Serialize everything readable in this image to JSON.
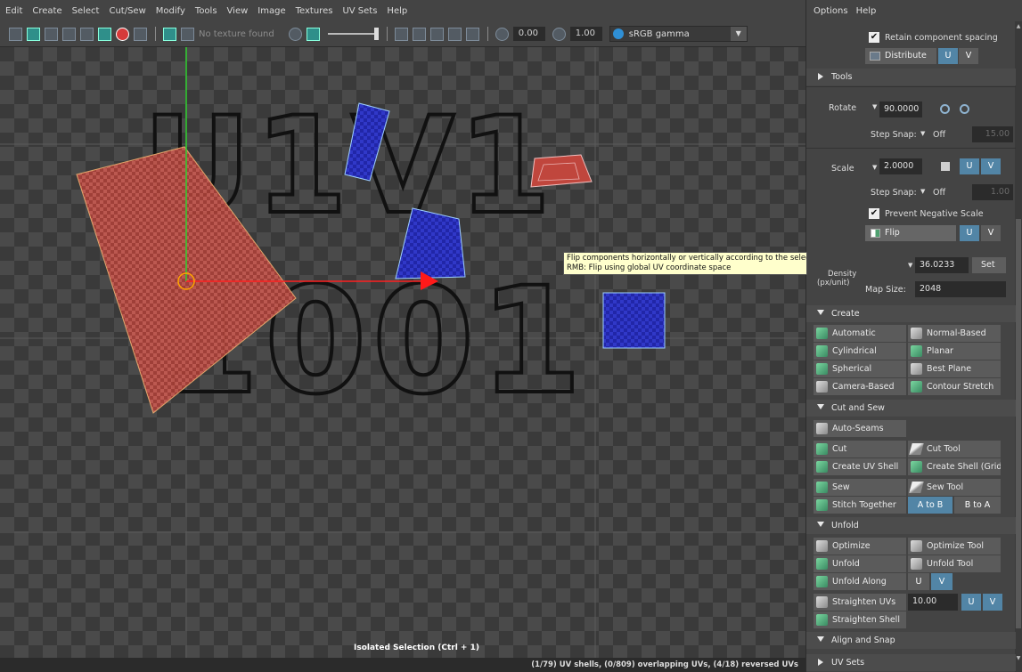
{
  "menu": [
    "Edit",
    "Create",
    "Select",
    "Cut/Sew",
    "Modify",
    "Tools",
    "View",
    "Image",
    "Textures",
    "UV Sets",
    "Help"
  ],
  "toolbar": {
    "texture_label": "No texture found",
    "exposure": "0.00",
    "gamma": "1.00",
    "colorspace": "sRGB gamma"
  },
  "viewport": {
    "tile_labels": [
      "U1V1",
      "1001"
    ],
    "isolated_label": "Isolated Selection (Ctrl + 1)",
    "colors": {
      "selected_shell": "#c0463d",
      "shell": "#2a2fcf",
      "x_axis": "#ff2020",
      "y_axis": "#30d030"
    }
  },
  "tooltip": {
    "line1": "Flip components horizontally or vertically according to the selection's pivot location",
    "line2": "RMB: Flip using global UV coordinate space"
  },
  "status": "(1/79) UV shells, (0/809) overlapping UVs, (4/18) reversed UVs",
  "panel": {
    "menu": [
      "Options",
      "Help"
    ],
    "retain_spacing": "Retain component spacing",
    "distribute": "Distribute",
    "u": "U",
    "v": "V",
    "tools_section": "Tools",
    "rotate_label": "Rotate",
    "rotate_value": "90.0000",
    "step_snap_label": "Step Snap:",
    "off": "Off",
    "rotate_step": "15.00",
    "scale_label": "Scale",
    "scale_value": "2.0000",
    "scale_step": "1.00",
    "prevent_negative": "Prevent Negative Scale",
    "flip": "Flip",
    "density_label": "Density",
    "density_unit": "(px/unit)",
    "density_value": "36.0233",
    "set": "Set",
    "map_size_label": "Map Size:",
    "map_size_value": "2048",
    "create_section": "Create",
    "create_buttons": [
      "Automatic",
      "Normal-Based",
      "Cylindrical",
      "Planar",
      "Spherical",
      "Best Plane",
      "Camera-Based",
      "Contour Stretch"
    ],
    "cutsew_section": "Cut and Sew",
    "auto_seams": "Auto-Seams",
    "cut": "Cut",
    "cut_tool": "Cut Tool",
    "create_uv_shell": "Create UV Shell",
    "create_shell_grid": "Create Shell (Grid)",
    "sew": "Sew",
    "sew_tool": "Sew Tool",
    "stitch_together": "Stitch Together",
    "a_to_b": "A to B",
    "b_to_a": "B to A",
    "unfold_section": "Unfold",
    "optimize": "Optimize",
    "optimize_tool": "Optimize Tool",
    "unfold": "Unfold",
    "unfold_tool": "Unfold Tool",
    "unfold_along": "Unfold Along",
    "straighten_uvs": "Straighten UVs",
    "straighten_value": "10.00",
    "straighten_shell": "Straighten Shell",
    "align_section": "Align and Snap",
    "uvsets_section": "UV Sets"
  }
}
